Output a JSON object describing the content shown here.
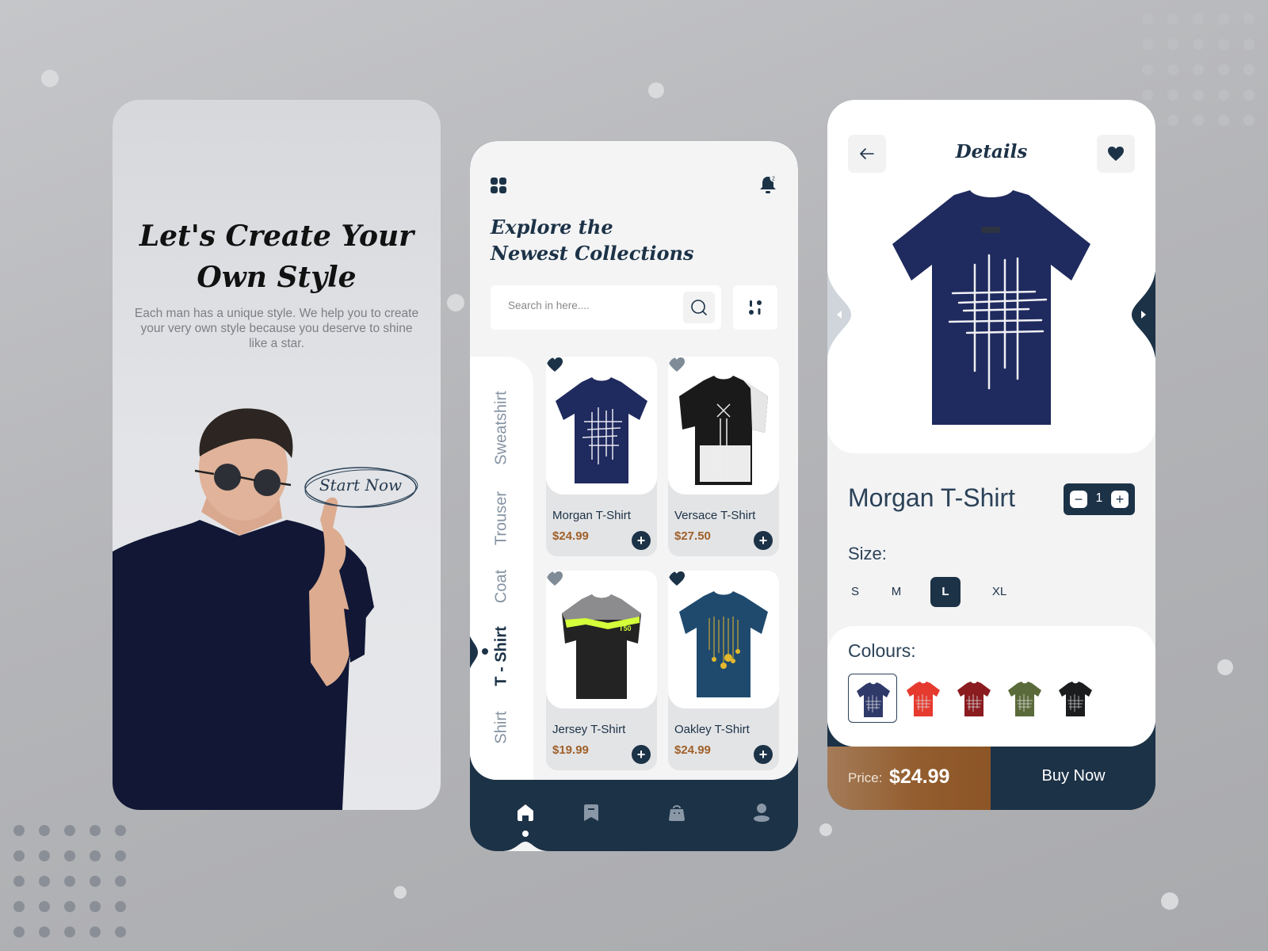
{
  "colors": {
    "navy": "#1c3247",
    "price": "#a0602a",
    "muted_text": "#8593a2",
    "background": "#b8b9bc"
  },
  "onboarding": {
    "title_line1": "Let's Create Your",
    "title_line2": "Own Style",
    "subtitle": "Each man has a unique style. We help you to create your very own style because you deserve to shine like a star.",
    "cta_label": "Start Now"
  },
  "catalog": {
    "menu_icon": "grid-icon",
    "notification_icon": "bell-icon",
    "notification_count": "2",
    "title_line1": "Explore the",
    "title_line2": "Newest Collections",
    "search": {
      "placeholder": "Search in here....",
      "value": ""
    },
    "filter_icon": "filter-icon",
    "categories": [
      {
        "label": "Sweatshirt",
        "active": false
      },
      {
        "label": "Trouser",
        "active": false
      },
      {
        "label": "Coat",
        "active": false
      },
      {
        "label": "T - Shirt",
        "active": true
      },
      {
        "label": "Shirt",
        "active": false
      }
    ],
    "products": [
      {
        "name": "Morgan T-Shirt",
        "price": "$24.99",
        "favorite": true,
        "shirt_color": "#1f2a5e"
      },
      {
        "name": "Versace T-Shirt",
        "price": "$27.50",
        "favorite": false,
        "shirt_color": "#1a1a1a"
      },
      {
        "name": "Jersey T-Shirt",
        "price": "$19.99",
        "favorite": false,
        "shirt_color": "#232323"
      },
      {
        "name": "Oakley T-Shirt",
        "price": "$24.99",
        "favorite": true,
        "shirt_color": "#1f4a6e"
      }
    ],
    "nav": [
      {
        "name": "home",
        "active": true
      },
      {
        "name": "bookmark",
        "active": false
      },
      {
        "name": "bag",
        "active": false
      },
      {
        "name": "profile",
        "active": false
      }
    ]
  },
  "details": {
    "title": "Details",
    "product_name": "Morgan T-Shirt",
    "quantity": "1",
    "size_label": "Size:",
    "sizes": [
      {
        "label": "S",
        "active": false
      },
      {
        "label": "M",
        "active": false
      },
      {
        "label": "L",
        "active": true
      },
      {
        "label": "XL",
        "active": false
      }
    ],
    "colours_label": "Colours:",
    "colours": [
      {
        "name": "navy",
        "hex": "#2f3a6a",
        "active": true
      },
      {
        "name": "red",
        "hex": "#e63a2e",
        "active": false
      },
      {
        "name": "maroon",
        "hex": "#8a1b1f",
        "active": false
      },
      {
        "name": "olive",
        "hex": "#5a6a3a",
        "active": false
      },
      {
        "name": "black",
        "hex": "#1b1c1e",
        "active": false
      }
    ],
    "price_label": "Price:",
    "price": "$24.99",
    "buy_label": "Buy Now"
  }
}
